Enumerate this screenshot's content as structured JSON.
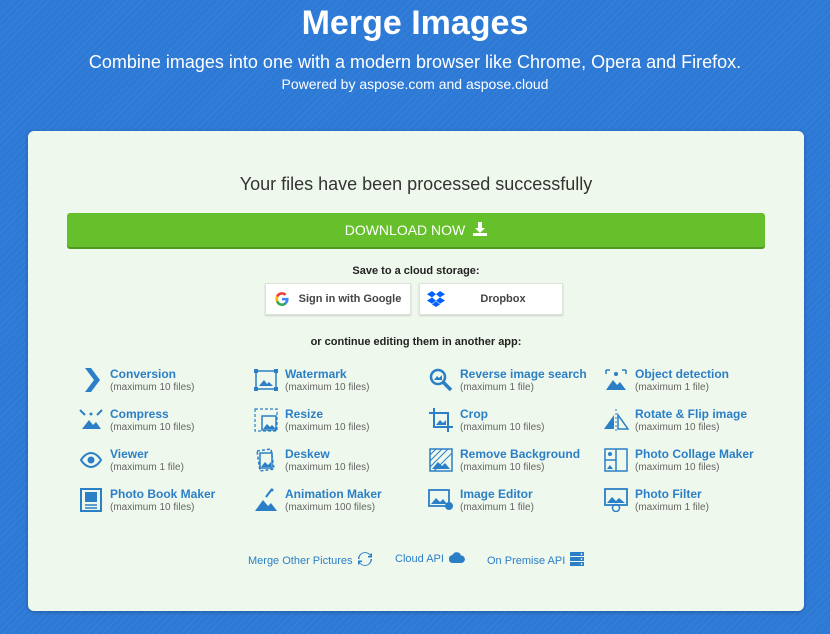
{
  "header": {
    "title": "Merge Images",
    "subtitle": "Combine images into one with a modern browser like Chrome, Opera and Firefox.",
    "powered": "Powered by aspose.com and aspose.cloud"
  },
  "card": {
    "success_message": "Your files have been processed successfully",
    "download_label": "DOWNLOAD NOW",
    "save_label": "Save to a cloud storage:",
    "google_label": "Sign in with Google",
    "dropbox_label": "Dropbox",
    "continue_label": "or continue editing them in another app:"
  },
  "apps": [
    {
      "name": "Conversion",
      "limit": "(maximum 10 files)",
      "icon": "chevron-right-icon"
    },
    {
      "name": "Watermark",
      "limit": "(maximum 10 files)",
      "icon": "watermark-icon"
    },
    {
      "name": "Reverse image search",
      "limit": "(maximum 1 file)",
      "icon": "reverse-search-icon"
    },
    {
      "name": "Object detection",
      "limit": "(maximum 1 file)",
      "icon": "object-detection-icon"
    },
    {
      "name": "Compress",
      "limit": "(maximum 10 files)",
      "icon": "compress-icon"
    },
    {
      "name": "Resize",
      "limit": "(maximum 10 files)",
      "icon": "resize-icon"
    },
    {
      "name": "Crop",
      "limit": "(maximum 10 files)",
      "icon": "crop-icon"
    },
    {
      "name": "Rotate & Flip image",
      "limit": "(maximum 10 files)",
      "icon": "rotate-flip-icon"
    },
    {
      "name": "Viewer",
      "limit": "(maximum 1 file)",
      "icon": "eye-icon"
    },
    {
      "name": "Deskew",
      "limit": "(maximum 10 files)",
      "icon": "deskew-icon"
    },
    {
      "name": "Remove Background",
      "limit": "(maximum 10 files)",
      "icon": "remove-background-icon"
    },
    {
      "name": "Photo Collage Maker",
      "limit": "(maximum 10 files)",
      "icon": "collage-icon"
    },
    {
      "name": "Photo Book Maker",
      "limit": "(maximum 10 files)",
      "icon": "photo-book-icon"
    },
    {
      "name": "Animation Maker",
      "limit": "(maximum 100 files)",
      "icon": "animation-icon"
    },
    {
      "name": "Image Editor",
      "limit": "(maximum 1 file)",
      "icon": "image-editor-icon"
    },
    {
      "name": "Photo Filter",
      "limit": "(maximum 1 file)",
      "icon": "photo-filter-icon"
    }
  ],
  "footer": {
    "merge_other": "Merge Other Pictures",
    "cloud_api": "Cloud API",
    "on_premise": "On Premise API"
  },
  "colors": {
    "background": "#2d79d6",
    "card": "#eff8ec",
    "download": "#65c02b",
    "link": "#2b7fc7",
    "icon": "#2b7fc7"
  }
}
